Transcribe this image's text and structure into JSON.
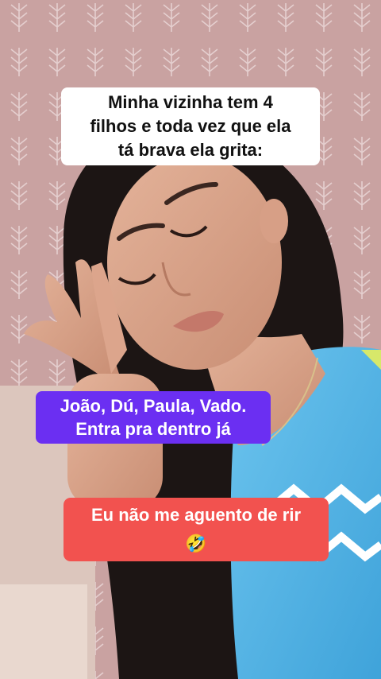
{
  "captions": {
    "top": "Minha vizinha tem  4\nfilhos e toda vez que ela\ntá brava ela grita:",
    "middle": "João, Dú, Paula, Vado.\nEntra pra dentro já",
    "bottom": "Eu não me aguento de rir\n🤣"
  },
  "colors": {
    "wallpaper": "#c9a1a0",
    "middle_caption_bg": "#6b2ff2",
    "bottom_caption_bg": "#f2524f",
    "shirt": "#5fb8e6"
  }
}
